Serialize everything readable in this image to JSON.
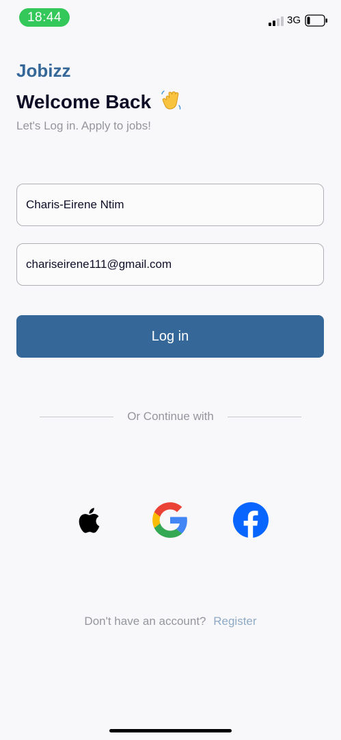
{
  "status_bar": {
    "time": "18:44",
    "network": "3G",
    "signal_bars_active": 2,
    "signal_bars_total": 4,
    "battery_level": 0.15
  },
  "header": {
    "brand": "Jobizz",
    "welcome": "Welcome Back",
    "emoji_icon": "waving-hand",
    "subtitle": "Let's Log in. Apply to jobs!"
  },
  "form": {
    "name_value": "Charis-Eirene Ntim",
    "email_value": "chariseirene111@gmail.com",
    "login_label": "Log in"
  },
  "social": {
    "divider_text": "Or Continue with",
    "providers": [
      "apple-logo",
      "google-logo",
      "facebook-logo"
    ]
  },
  "footer": {
    "register_prompt": "Don't have an account?",
    "register_link": "Register"
  },
  "colors": {
    "brand": "#356899",
    "background": "#f8f8fa",
    "time_pill": "#34c759"
  }
}
